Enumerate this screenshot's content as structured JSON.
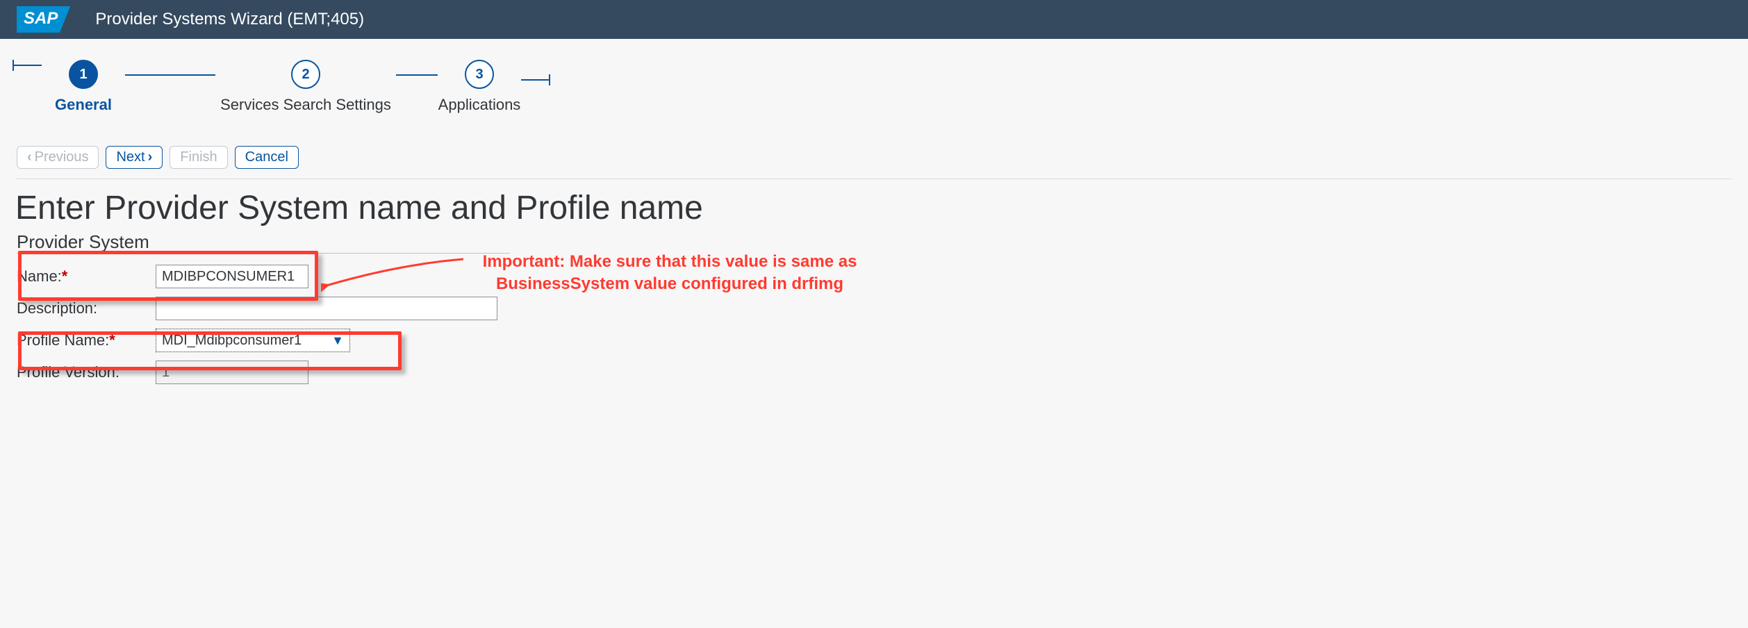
{
  "header": {
    "logo": "SAP",
    "title": "Provider Systems Wizard (EMT;405)"
  },
  "wizard": {
    "steps": [
      {
        "num": "1",
        "label": "General",
        "active": true
      },
      {
        "num": "2",
        "label": "Services Search Settings",
        "active": false
      },
      {
        "num": "3",
        "label": "Applications",
        "active": false
      }
    ]
  },
  "toolbar": {
    "previous": "Previous",
    "next": "Next",
    "finish": "Finish",
    "cancel": "Cancel"
  },
  "page": {
    "title": "Enter Provider System name and Profile name",
    "section": "Provider System"
  },
  "form": {
    "name": {
      "label": "Name:",
      "value": "MDIBPCONSUMER1",
      "required": true
    },
    "description": {
      "label": "Description:",
      "value": ""
    },
    "profile_name": {
      "label": "Profile Name:",
      "value": "MDI_Mdibpconsumer1",
      "required": true
    },
    "profile_version": {
      "label": "Profile Version:",
      "value": "1"
    }
  },
  "annotation": {
    "line1": "Important: Make sure that this value is same as",
    "line2": "BusinessSystem value configured in drfimg"
  }
}
